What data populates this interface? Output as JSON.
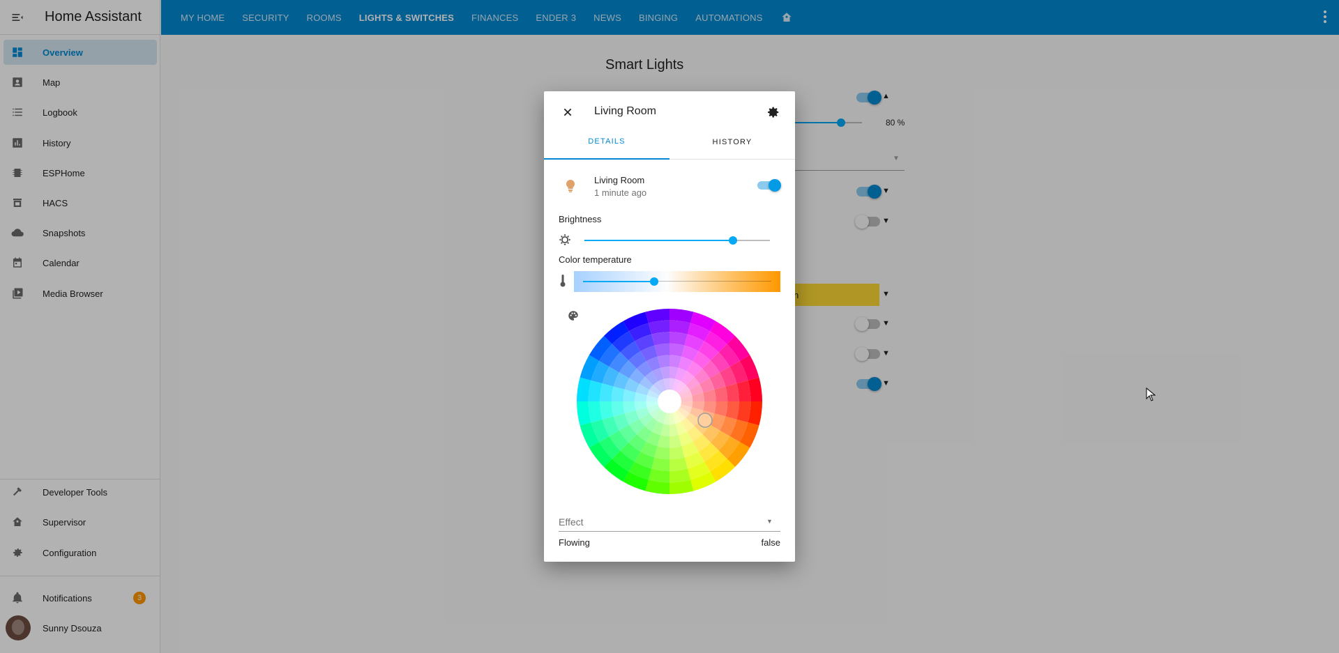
{
  "app": {
    "title": "Home Assistant"
  },
  "sidebar": {
    "items": [
      {
        "label": "Overview",
        "icon": "dashboard-icon",
        "active": true
      },
      {
        "label": "Map",
        "icon": "map-account-icon"
      },
      {
        "label": "Logbook",
        "icon": "list-icon"
      },
      {
        "label": "History",
        "icon": "chart-box-icon"
      },
      {
        "label": "ESPHome",
        "icon": "chip-icon"
      },
      {
        "label": "HACS",
        "icon": "hacs-icon"
      },
      {
        "label": "Snapshots",
        "icon": "cloud-icon"
      },
      {
        "label": "Calendar",
        "icon": "calendar-icon"
      },
      {
        "label": "Media Browser",
        "icon": "play-box-multiple-icon"
      }
    ],
    "bottom_items": [
      {
        "label": "Developer Tools",
        "icon": "hammer-icon"
      },
      {
        "label": "Supervisor",
        "icon": "home-assistant-icon"
      },
      {
        "label": "Configuration",
        "icon": "cog-icon"
      }
    ],
    "notifications": {
      "label": "Notifications",
      "count": "3"
    },
    "user": {
      "name": "Sunny Dsouza"
    }
  },
  "header": {
    "tabs": [
      {
        "label": "MY HOME"
      },
      {
        "label": "SECURITY"
      },
      {
        "label": "ROOMS"
      },
      {
        "label": "LIGHTS & SWITCHES",
        "active": true
      },
      {
        "label": "FINANCES"
      },
      {
        "label": "ENDER 3"
      },
      {
        "label": "NEWS"
      },
      {
        "label": "BINGING"
      },
      {
        "label": "AUTOMATIONS"
      }
    ]
  },
  "page": {
    "title": "Smart Lights",
    "brightness_readout": "80 %",
    "yellow_button_tail": "n"
  },
  "dialog": {
    "title": "Living Room",
    "tabs": [
      "DETAILS",
      "HISTORY"
    ],
    "entity": {
      "name": "Living Room",
      "last_changed": "1 minute ago",
      "state_on": true
    },
    "brightness": {
      "label": "Brightness",
      "level": 0.8
    },
    "color_temp": {
      "label": "Color temperature",
      "level": 0.36
    },
    "effect": {
      "label": "Effect",
      "value": ""
    },
    "attributes": [
      {
        "key": "Flowing",
        "value": "false"
      }
    ]
  },
  "colors": {
    "primary": "#0288d1",
    "accent": "#03a9f4",
    "badge": "#ff9800",
    "bulb": "#e0a26b"
  }
}
